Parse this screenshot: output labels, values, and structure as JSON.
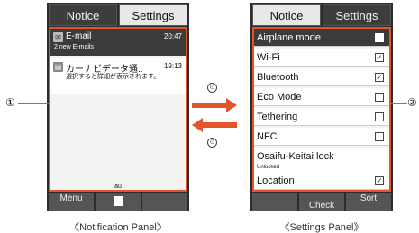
{
  "notification_phone": {
    "tabs": {
      "notice": "Notice",
      "settings": "Settings"
    },
    "notifications": [
      {
        "icon": "email-icon",
        "title": "E-mail",
        "time": "20:47",
        "detail": "2 new E-mails"
      },
      {
        "icon": "car-nav-icon",
        "title": "カーナビデータ通..",
        "time": "19:13",
        "detail": "選択すると詳細が表示されます。"
      }
    ],
    "carrier": "au",
    "softkeys": {
      "left": "Menu",
      "center": "",
      "right": ""
    }
  },
  "settings_phone": {
    "tabs": {
      "notice": "Notice",
      "settings": "Settings"
    },
    "items": [
      {
        "label": "Airplane mode",
        "checked": false,
        "selected": true
      },
      {
        "label": "Wi-Fi",
        "checked": true
      },
      {
        "label": "Bluetooth",
        "checked": true
      },
      {
        "label": "Eco Mode",
        "checked": false
      },
      {
        "label": "Tethering",
        "checked": false
      },
      {
        "label": "NFC",
        "checked": false
      },
      {
        "label": "Osaifu-Keitai lock",
        "status": "Unlocked"
      },
      {
        "label": "Location",
        "checked": true
      }
    ],
    "softkeys": {
      "left": "",
      "center": "Check",
      "right": "Sort"
    }
  },
  "callouts": {
    "left": "①",
    "right": "②"
  },
  "transition_icons": {
    "right_arrow_key": "⊙",
    "left_arrow_key": "⊙"
  },
  "captions": {
    "left": "《Notification Panel》",
    "right": "《Settings Panel》"
  },
  "colors": {
    "accent": "#e4532a",
    "panel_dark": "#2c2c2c",
    "selected_row": "#3b3b3b"
  }
}
